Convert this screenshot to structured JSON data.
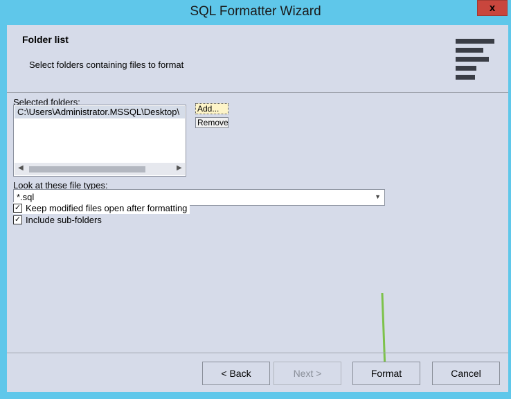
{
  "window": {
    "title": "SQL Formatter Wizard",
    "close_label": "x"
  },
  "header": {
    "title": "Folder list",
    "subtitle": "Select folders containing files to format",
    "icon": "align-left-lines-icon"
  },
  "folders": {
    "label": "Selected folders:",
    "items": [
      "C:\\Users\\Administrator.MSSQL\\Desktop\\"
    ],
    "add_label": "Add...",
    "remove_label": "Remove"
  },
  "file_types": {
    "label": "Look at these file types:",
    "value": "*.sql"
  },
  "options": {
    "keep_open": {
      "label": "Keep modified files open after formatting",
      "checked": true
    },
    "include_subfolders": {
      "label": "Include sub-folders",
      "checked": true
    }
  },
  "footer": {
    "back_label": "< Back",
    "next_label": "Next >",
    "format_label": "Format",
    "cancel_label": "Cancel"
  },
  "colors": {
    "titlebar": "#5fc7ea",
    "panel": "#d6dbe9",
    "close": "#c9463d",
    "annotation": "#7dc24b"
  }
}
